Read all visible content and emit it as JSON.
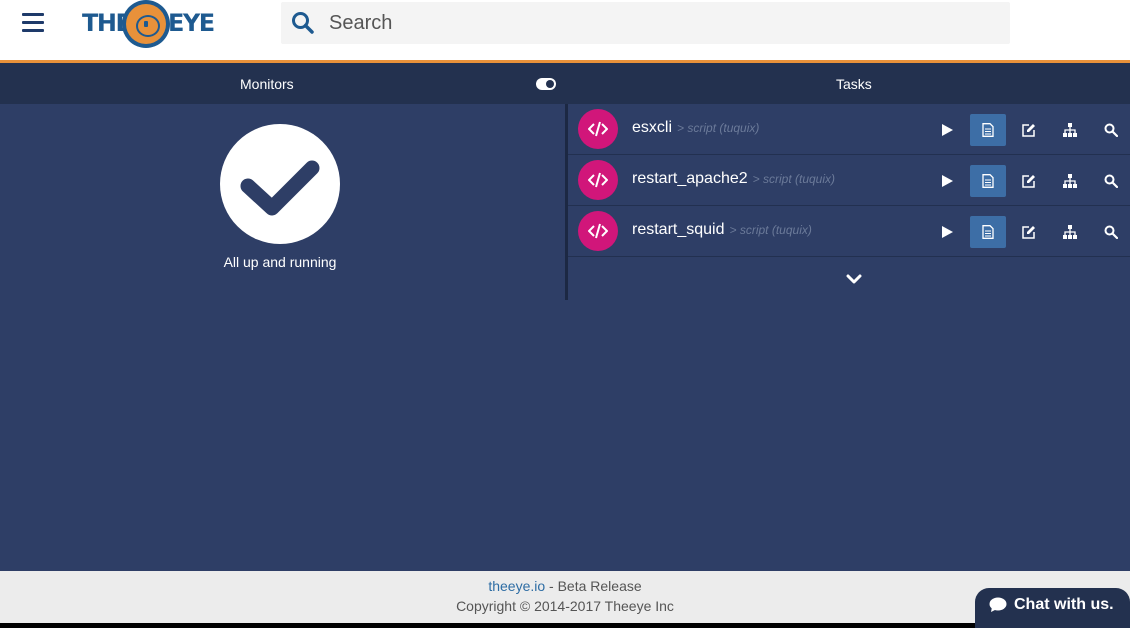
{
  "header": {
    "brand_left": "THE",
    "brand_right": "EYE",
    "search_placeholder": "Search"
  },
  "sections": {
    "monitors_title": "Monitors",
    "tasks_title": "Tasks"
  },
  "monitors": {
    "status_text": "All up and running"
  },
  "tasks": [
    {
      "name": "esxcli",
      "meta": "> script (tuquix)"
    },
    {
      "name": "restart_apache2",
      "meta": "> script (tuquix)"
    },
    {
      "name": "restart_squid",
      "meta": "> script (tuquix)"
    }
  ],
  "footer": {
    "link_text": "theeye.io",
    "release_text": " - Beta Release",
    "copyright": "Copyright © 2014-2017 Theeye Inc"
  },
  "chat": {
    "label": "Chat with us."
  },
  "colors": {
    "brand_blue": "#1e5a90",
    "brand_orange": "#e8913a",
    "background": "#2e3e66",
    "section_bar": "#23314f",
    "task_badge": "#d1167a",
    "active_button": "#3d6ea6"
  }
}
